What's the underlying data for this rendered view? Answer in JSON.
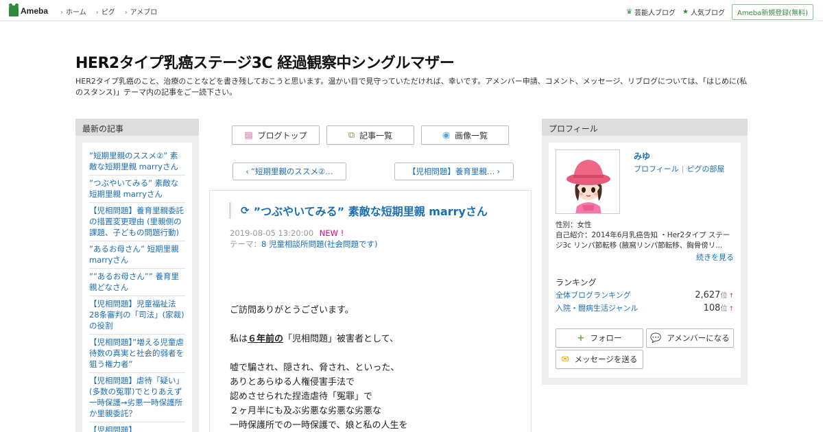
{
  "header_bar": {
    "logo": "Ameba",
    "nav": [
      "ホーム",
      "ピグ",
      "アメブロ"
    ],
    "right_links": [
      "芸能人ブログ",
      "人気ブログ"
    ],
    "register": "Ameba新規登録(無料)"
  },
  "blog": {
    "title": "HER2タイプ乳癌ステージ3C 経過観察中シングルマザー",
    "description": "HER2タイプ乳癌のこと、治療のことなどを書き残しておこうと思います。温かい目で見守っていただければ、幸いです。アメンバー申請、コメント、メッセージ、リブログについては、「はじめに(私のスタンス)」テーマ内の記事をご一読下さい。"
  },
  "recent": {
    "heading": "最新の記事",
    "items": [
      "”短期里親のススメ②” 素敵な短期里親 marryさん",
      "”つぶやいてみる” 素敵な短期里親 marryさん",
      "【児相問題】養育里親委託の措置変更理由 (里親側の課題、子どもの問題行動)",
      "”あるお母さん” 短期里親 marryさん",
      "””あるお母さん”” 養育里親どなさん",
      "【児相問題】児童福祉法28条審判の「司法」(家裁)の役割",
      "【児相問題】”増える児童虐待数の真実と社会的弱者を狙う権力者”",
      "【児相問題】虐待「疑い」(多数の冤罪)でとりあえず一時保護→劣悪一時保護所か里親委託？",
      "【児相問題】"
    ]
  },
  "center_nav": {
    "blog_top": "ブログトップ",
    "article_list": "記事一覧",
    "image_list": "画像一覧",
    "prev": "”短期里親のススメ②…",
    "next": "【児相問題】養育里親…"
  },
  "article": {
    "title": "”つぶやいてみる” 素敵な短期里親 marryさん",
    "date": "2019-08-05 13:20:00",
    "new_badge": "NEW !",
    "theme_label": "テーマ：",
    "theme": "8 児童相談所問題(社会問題です)",
    "line1": "ご訪問ありがとうございます。",
    "line2_pre": "私は",
    "line2_em": "６年前の",
    "line2_post": "「児相問題」被害者として、",
    "line3": "嘘で騙され、隠され、脅され、といった、",
    "line4": "ありとあらゆる人権侵害手法で",
    "line5": "認めさせられた捏造虐待「冤罪」で",
    "line6": "２ヶ月半にも及ぶ劣悪な劣悪な劣悪な",
    "line7": "一時保護所での一時保護で、娘と私の人生を"
  },
  "profile": {
    "heading": "プロフィール",
    "name": "みゆ",
    "link_profile": "プロフィール",
    "link_pig": "ピグの部屋",
    "gender": "性別：女性",
    "intro": "自己紹介：2014年6月乳癌告知 ・Her2タイプ ステージ3c リンパ節転移 (腋窩リンパ節転移、胸骨傍リ...",
    "more": "続きを見る",
    "ranking_heading": "ランキング",
    "rankings": [
      {
        "name": "全体ブログランキング",
        "value": "2,627",
        "unit": "位"
      },
      {
        "name": "入院・闘病生活ジャンル",
        "value": "108",
        "unit": "位"
      }
    ],
    "follow": "フォロー",
    "amember": "アメンバーになる",
    "message": "メッセージを送る"
  },
  "colors": {
    "link": "#1a6fb5",
    "brand_green": "#2d8c3c",
    "new_badge": "#e4007f"
  }
}
